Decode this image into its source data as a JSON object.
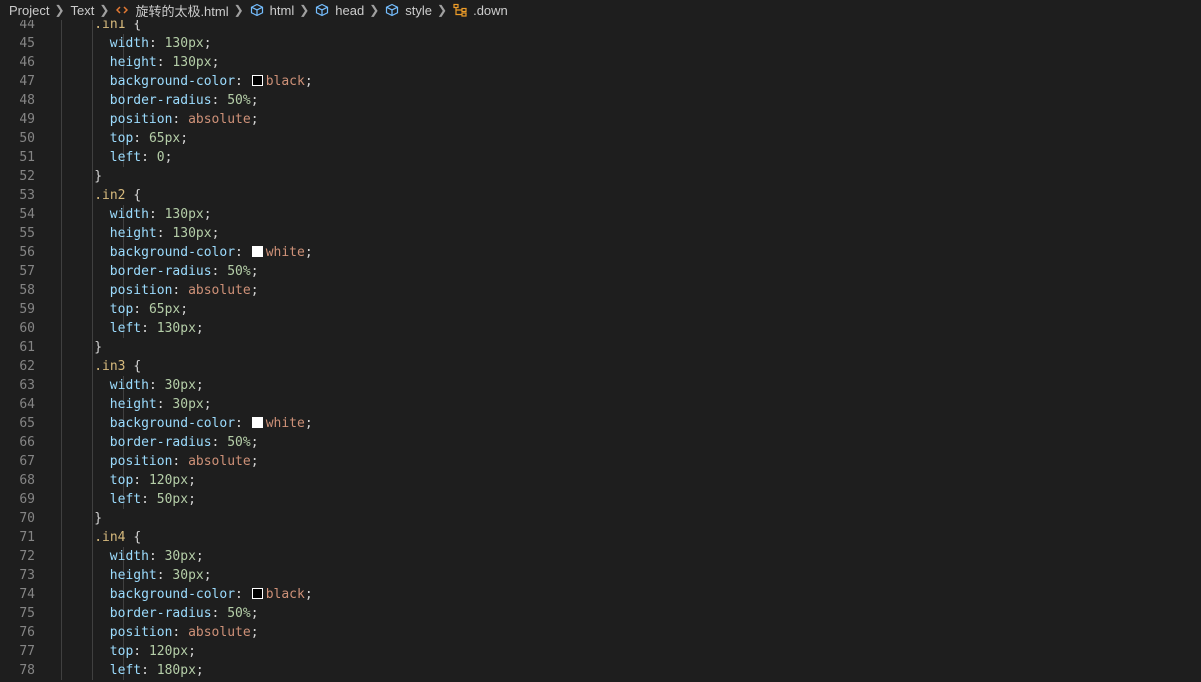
{
  "breadcrumb": [
    {
      "label": "Project",
      "icon": "none"
    },
    {
      "label": "Text",
      "icon": "none"
    },
    {
      "label": "旋转的太极.html",
      "icon": "html-file-icon"
    },
    {
      "label": "html",
      "icon": "element-cube-icon"
    },
    {
      "label": "head",
      "icon": "element-cube-icon"
    },
    {
      "label": "style",
      "icon": "element-cube-icon"
    },
    {
      "label": ".down",
      "icon": "css-selector-icon"
    }
  ],
  "colors": {
    "background": "#1e1e1e",
    "selector": "#d7ba7d",
    "property": "#9cdcfe",
    "number": "#b5cea8",
    "keyword": "#ce9178",
    "line_number": "#858585"
  },
  "code_lines": [
    {
      "n": "44",
      "indent": 4,
      "segments": [
        {
          "t": ".in1",
          "c": "sel"
        },
        {
          "t": " {",
          "c": "punc"
        }
      ]
    },
    {
      "n": "45",
      "indent": 6,
      "segments": [
        {
          "t": "width",
          "c": "prop"
        },
        {
          "t": ": ",
          "c": "punc"
        },
        {
          "t": "130px",
          "c": "num"
        },
        {
          "t": ";",
          "c": "punc"
        }
      ]
    },
    {
      "n": "46",
      "indent": 6,
      "segments": [
        {
          "t": "height",
          "c": "prop"
        },
        {
          "t": ": ",
          "c": "punc"
        },
        {
          "t": "130px",
          "c": "num"
        },
        {
          "t": ";",
          "c": "punc"
        }
      ]
    },
    {
      "n": "47",
      "indent": 6,
      "segments": [
        {
          "t": "background-color",
          "c": "prop"
        },
        {
          "t": ": ",
          "c": "punc"
        },
        {
          "t": "",
          "c": "swatch",
          "color": "#000000"
        },
        {
          "t": "black",
          "c": "kw"
        },
        {
          "t": ";",
          "c": "punc"
        }
      ]
    },
    {
      "n": "48",
      "indent": 6,
      "segments": [
        {
          "t": "border-radius",
          "c": "prop"
        },
        {
          "t": ": ",
          "c": "punc"
        },
        {
          "t": "50%",
          "c": "num"
        },
        {
          "t": ";",
          "c": "punc"
        }
      ]
    },
    {
      "n": "49",
      "indent": 6,
      "segments": [
        {
          "t": "position",
          "c": "prop"
        },
        {
          "t": ": ",
          "c": "punc"
        },
        {
          "t": "absolute",
          "c": "kw"
        },
        {
          "t": ";",
          "c": "punc"
        }
      ]
    },
    {
      "n": "50",
      "indent": 6,
      "segments": [
        {
          "t": "top",
          "c": "prop"
        },
        {
          "t": ": ",
          "c": "punc"
        },
        {
          "t": "65px",
          "c": "num"
        },
        {
          "t": ";",
          "c": "punc"
        }
      ]
    },
    {
      "n": "51",
      "indent": 6,
      "segments": [
        {
          "t": "left",
          "c": "prop"
        },
        {
          "t": ": ",
          "c": "punc"
        },
        {
          "t": "0",
          "c": "num"
        },
        {
          "t": ";",
          "c": "punc"
        }
      ]
    },
    {
      "n": "52",
      "indent": 4,
      "segments": [
        {
          "t": "}",
          "c": "punc"
        }
      ]
    },
    {
      "n": "53",
      "indent": 4,
      "segments": [
        {
          "t": ".in2",
          "c": "sel"
        },
        {
          "t": " {",
          "c": "punc"
        }
      ]
    },
    {
      "n": "54",
      "indent": 6,
      "segments": [
        {
          "t": "width",
          "c": "prop"
        },
        {
          "t": ": ",
          "c": "punc"
        },
        {
          "t": "130px",
          "c": "num"
        },
        {
          "t": ";",
          "c": "punc"
        }
      ]
    },
    {
      "n": "55",
      "indent": 6,
      "segments": [
        {
          "t": "height",
          "c": "prop"
        },
        {
          "t": ": ",
          "c": "punc"
        },
        {
          "t": "130px",
          "c": "num"
        },
        {
          "t": ";",
          "c": "punc"
        }
      ]
    },
    {
      "n": "56",
      "indent": 6,
      "segments": [
        {
          "t": "background-color",
          "c": "prop"
        },
        {
          "t": ": ",
          "c": "punc"
        },
        {
          "t": "",
          "c": "swatch",
          "color": "#ffffff"
        },
        {
          "t": "white",
          "c": "kw"
        },
        {
          "t": ";",
          "c": "punc"
        }
      ]
    },
    {
      "n": "57",
      "indent": 6,
      "segments": [
        {
          "t": "border-radius",
          "c": "prop"
        },
        {
          "t": ": ",
          "c": "punc"
        },
        {
          "t": "50%",
          "c": "num"
        },
        {
          "t": ";",
          "c": "punc"
        }
      ]
    },
    {
      "n": "58",
      "indent": 6,
      "segments": [
        {
          "t": "position",
          "c": "prop"
        },
        {
          "t": ": ",
          "c": "punc"
        },
        {
          "t": "absolute",
          "c": "kw"
        },
        {
          "t": ";",
          "c": "punc"
        }
      ]
    },
    {
      "n": "59",
      "indent": 6,
      "segments": [
        {
          "t": "top",
          "c": "prop"
        },
        {
          "t": ": ",
          "c": "punc"
        },
        {
          "t": "65px",
          "c": "num"
        },
        {
          "t": ";",
          "c": "punc"
        }
      ]
    },
    {
      "n": "60",
      "indent": 6,
      "segments": [
        {
          "t": "left",
          "c": "prop"
        },
        {
          "t": ": ",
          "c": "punc"
        },
        {
          "t": "130px",
          "c": "num"
        },
        {
          "t": ";",
          "c": "punc"
        }
      ]
    },
    {
      "n": "61",
      "indent": 4,
      "segments": [
        {
          "t": "}",
          "c": "punc"
        }
      ]
    },
    {
      "n": "62",
      "indent": 4,
      "segments": [
        {
          "t": ".in3",
          "c": "sel"
        },
        {
          "t": " {",
          "c": "punc"
        }
      ]
    },
    {
      "n": "63",
      "indent": 6,
      "segments": [
        {
          "t": "width",
          "c": "prop"
        },
        {
          "t": ": ",
          "c": "punc"
        },
        {
          "t": "30px",
          "c": "num"
        },
        {
          "t": ";",
          "c": "punc"
        }
      ]
    },
    {
      "n": "64",
      "indent": 6,
      "segments": [
        {
          "t": "height",
          "c": "prop"
        },
        {
          "t": ": ",
          "c": "punc"
        },
        {
          "t": "30px",
          "c": "num"
        },
        {
          "t": ";",
          "c": "punc"
        }
      ]
    },
    {
      "n": "65",
      "indent": 6,
      "segments": [
        {
          "t": "background-color",
          "c": "prop"
        },
        {
          "t": ": ",
          "c": "punc"
        },
        {
          "t": "",
          "c": "swatch",
          "color": "#ffffff"
        },
        {
          "t": "white",
          "c": "kw"
        },
        {
          "t": ";",
          "c": "punc"
        }
      ]
    },
    {
      "n": "66",
      "indent": 6,
      "segments": [
        {
          "t": "border-radius",
          "c": "prop"
        },
        {
          "t": ": ",
          "c": "punc"
        },
        {
          "t": "50%",
          "c": "num"
        },
        {
          "t": ";",
          "c": "punc"
        }
      ]
    },
    {
      "n": "67",
      "indent": 6,
      "segments": [
        {
          "t": "position",
          "c": "prop"
        },
        {
          "t": ": ",
          "c": "punc"
        },
        {
          "t": "absolute",
          "c": "kw"
        },
        {
          "t": ";",
          "c": "punc"
        }
      ]
    },
    {
      "n": "68",
      "indent": 6,
      "segments": [
        {
          "t": "top",
          "c": "prop"
        },
        {
          "t": ": ",
          "c": "punc"
        },
        {
          "t": "120px",
          "c": "num"
        },
        {
          "t": ";",
          "c": "punc"
        }
      ]
    },
    {
      "n": "69",
      "indent": 6,
      "segments": [
        {
          "t": "left",
          "c": "prop"
        },
        {
          "t": ": ",
          "c": "punc"
        },
        {
          "t": "50px",
          "c": "num"
        },
        {
          "t": ";",
          "c": "punc"
        }
      ]
    },
    {
      "n": "70",
      "indent": 4,
      "segments": [
        {
          "t": "}",
          "c": "punc"
        }
      ]
    },
    {
      "n": "71",
      "indent": 4,
      "segments": [
        {
          "t": ".in4",
          "c": "sel"
        },
        {
          "t": " {",
          "c": "punc"
        }
      ]
    },
    {
      "n": "72",
      "indent": 6,
      "segments": [
        {
          "t": "width",
          "c": "prop"
        },
        {
          "t": ": ",
          "c": "punc"
        },
        {
          "t": "30px",
          "c": "num"
        },
        {
          "t": ";",
          "c": "punc"
        }
      ]
    },
    {
      "n": "73",
      "indent": 6,
      "segments": [
        {
          "t": "height",
          "c": "prop"
        },
        {
          "t": ": ",
          "c": "punc"
        },
        {
          "t": "30px",
          "c": "num"
        },
        {
          "t": ";",
          "c": "punc"
        }
      ]
    },
    {
      "n": "74",
      "indent": 6,
      "segments": [
        {
          "t": "background-color",
          "c": "prop"
        },
        {
          "t": ": ",
          "c": "punc"
        },
        {
          "t": "",
          "c": "swatch",
          "color": "#000000"
        },
        {
          "t": "black",
          "c": "kw"
        },
        {
          "t": ";",
          "c": "punc"
        }
      ]
    },
    {
      "n": "75",
      "indent": 6,
      "segments": [
        {
          "t": "border-radius",
          "c": "prop"
        },
        {
          "t": ": ",
          "c": "punc"
        },
        {
          "t": "50%",
          "c": "num"
        },
        {
          "t": ";",
          "c": "punc"
        }
      ]
    },
    {
      "n": "76",
      "indent": 6,
      "segments": [
        {
          "t": "position",
          "c": "prop"
        },
        {
          "t": ": ",
          "c": "punc"
        },
        {
          "t": "absolute",
          "c": "kw"
        },
        {
          "t": ";",
          "c": "punc"
        }
      ]
    },
    {
      "n": "77",
      "indent": 6,
      "segments": [
        {
          "t": "top",
          "c": "prop"
        },
        {
          "t": ": ",
          "c": "punc"
        },
        {
          "t": "120px",
          "c": "num"
        },
        {
          "t": ";",
          "c": "punc"
        }
      ]
    },
    {
      "n": "78",
      "indent": 6,
      "segments": [
        {
          "t": "left",
          "c": "prop"
        },
        {
          "t": ": ",
          "c": "punc"
        },
        {
          "t": "180px",
          "c": "num"
        },
        {
          "t": ";",
          "c": "punc"
        }
      ]
    }
  ]
}
